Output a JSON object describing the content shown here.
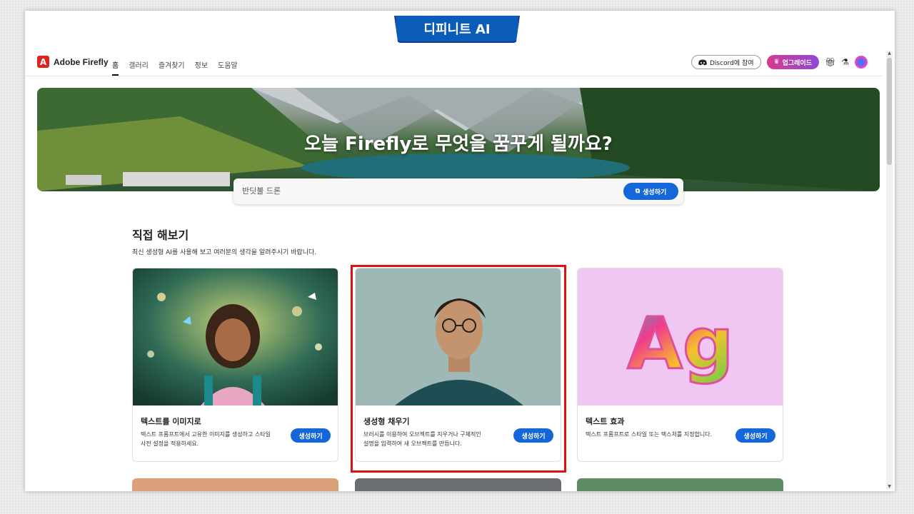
{
  "overlay": {
    "brand_label": "디피니트 AI"
  },
  "header": {
    "logo_text": "Adobe Firefly",
    "logo_mark": "A",
    "nav": [
      "홈",
      "갤러리",
      "즐겨찾기",
      "정보",
      "도움말"
    ],
    "discord_label": "Discord에 참여",
    "upgrade_label": "업그레이드",
    "icons": [
      "discord-icon",
      "crown-icon",
      "gift-icon",
      "flask-icon",
      "profile-avatar"
    ]
  },
  "hero": {
    "title": "오늘 Firefly로 무엇을 꿈꾸게 될까요?",
    "prompt_value": "반딧불 드론",
    "generate_label": "생성하기"
  },
  "section": {
    "title": "직접 해보기",
    "description": "최신 생성형 AI를 사용해 보고 여러분의 생각을 알려주시기 바랍니다."
  },
  "cards": [
    {
      "title": "텍스트를 이미지로",
      "desc_line1": "텍스트 프롬프트에서 고유한 이미지를 생성하고 스타일",
      "desc_line2": "사전 설정을 적용하세요.",
      "button": "생성하기"
    },
    {
      "title": "생성형 채우기",
      "desc_line1": "브러시를 이용하여 오브젝트를 지우거나 구체적인",
      "desc_line2": "설명을 입력하여 새 오브젝트를 만듭니다.",
      "button": "생성하기"
    },
    {
      "title": "텍스트 효과",
      "desc_line1": "텍스트 프롬프트로 스타일 또는 텍스처를 지정합니다.",
      "desc_line2": "",
      "button": "생성하기",
      "art_text": "Ag"
    }
  ],
  "colors": {
    "accent": "#1467d9",
    "highlight": "#e01010",
    "brand_tab": "#0b5cb8"
  }
}
